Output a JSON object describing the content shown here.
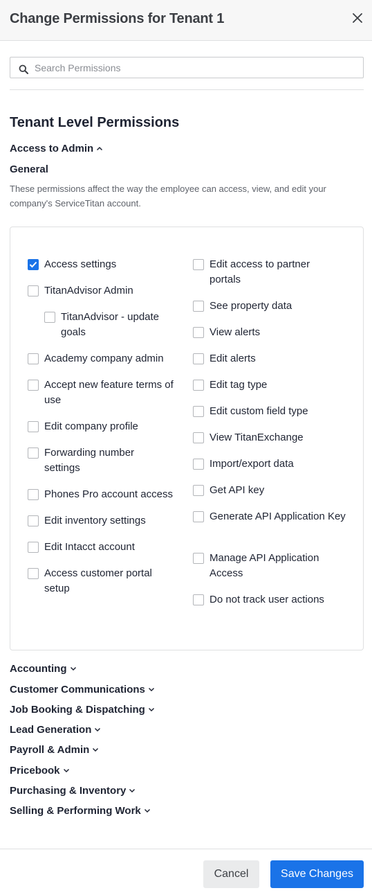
{
  "modal": {
    "title": "Change Permissions for Tenant 1"
  },
  "search": {
    "placeholder": "Search Permissions",
    "value": ""
  },
  "section": {
    "title": "Tenant Level Permissions"
  },
  "access_group": {
    "label": "Access to Admin",
    "expanded": true,
    "subsection_title": "General",
    "description": "These permissions affect the way the employee can access, view, and edit your company's ServiceTitan account."
  },
  "permissions": {
    "left": [
      {
        "label": "Access settings",
        "checked": true
      },
      {
        "label": "TitanAdvisor Admin",
        "checked": false
      },
      {
        "label": "TitanAdvisor - update goals",
        "checked": false
      },
      {
        "label": "Academy company admin",
        "checked": false
      },
      {
        "label": "Accept new feature terms of use",
        "checked": false
      },
      {
        "label": "Edit company profile",
        "checked": false
      },
      {
        "label": "Forwarding number settings",
        "checked": false
      },
      {
        "label": "Phones Pro account access",
        "checked": false
      },
      {
        "label": "Edit inventory settings",
        "checked": false
      },
      {
        "label": "Edit Intacct account",
        "checked": false
      },
      {
        "label": "Access customer portal setup",
        "checked": false
      }
    ],
    "right": [
      {
        "label": "Edit access to partner portals",
        "checked": false
      },
      {
        "label": "See property data",
        "checked": false
      },
      {
        "label": "View alerts",
        "checked": false
      },
      {
        "label": "Edit alerts",
        "checked": false
      },
      {
        "label": "Edit tag type",
        "checked": false
      },
      {
        "label": "Edit custom field type",
        "checked": false
      },
      {
        "label": "View TitanExchange",
        "checked": false
      },
      {
        "label": "Import/export data",
        "checked": false
      },
      {
        "label": "Get API key",
        "checked": false
      },
      {
        "label": "Generate API Application Key",
        "checked": false
      },
      {
        "label": "Manage API Application Access",
        "checked": false
      },
      {
        "label": "Do not track user actions",
        "checked": false
      }
    ]
  },
  "categories": [
    {
      "label": "Accounting"
    },
    {
      "label": "Customer Communications"
    },
    {
      "label": "Job Booking & Dispatching"
    },
    {
      "label": "Lead Generation"
    },
    {
      "label": "Payroll & Admin"
    },
    {
      "label": "Pricebook"
    },
    {
      "label": "Purchasing & Inventory"
    },
    {
      "label": "Selling & Performing Work"
    }
  ],
  "footer": {
    "cancel_label": "Cancel",
    "save_label": "Save Changes"
  },
  "colors": {
    "accent": "#1a73e8",
    "header_bg": "#f7f7f7",
    "text": "#1f2433"
  },
  "icons": {
    "close": "close-icon",
    "search": "search-icon",
    "expanded": "chevron-up-icon",
    "collapsed": "chevron-down-icon",
    "checked": "checkmark-icon"
  }
}
